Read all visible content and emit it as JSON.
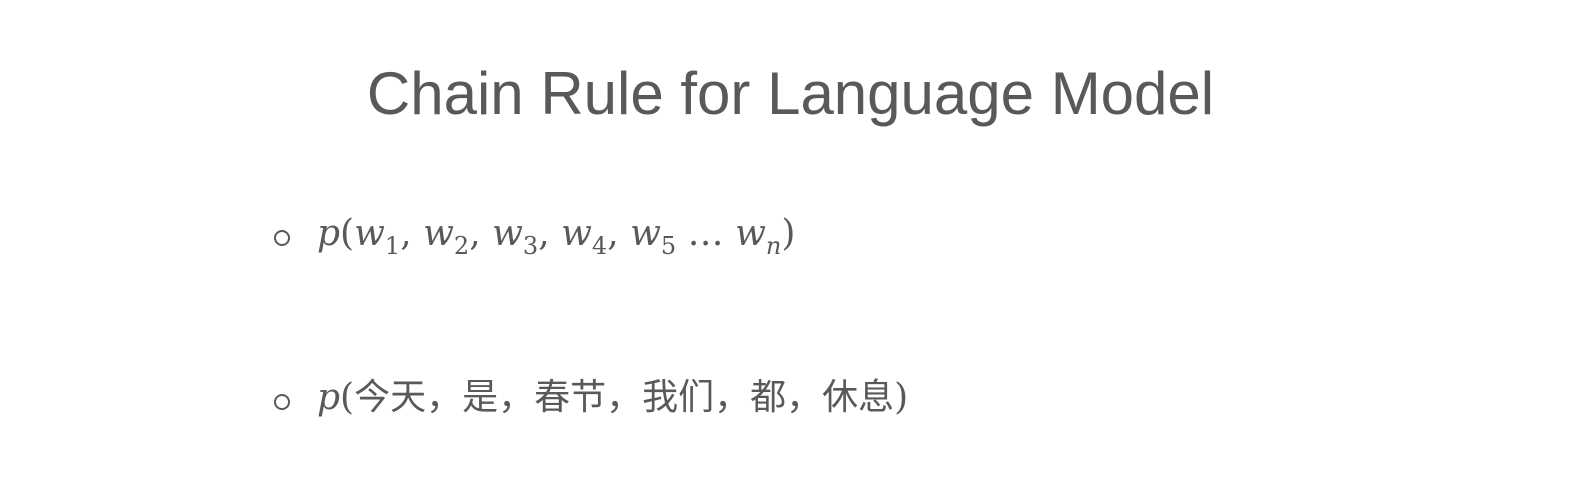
{
  "title": "Chain Rule for Language Model",
  "bullets": [
    {
      "prob_symbol": "p",
      "open_paren": "(",
      "close_paren": ")",
      "terms": [
        {
          "var": "w",
          "sub": "1",
          "sep": ", "
        },
        {
          "var": "w",
          "sub": "2",
          "sep": ", "
        },
        {
          "var": "w",
          "sub": "3",
          "sep": ", "
        },
        {
          "var": "w",
          "sub": "4",
          "sep": ", "
        },
        {
          "var": "w",
          "sub": "5",
          "sep": " … "
        },
        {
          "var": "w",
          "sub": "n",
          "sep": ""
        }
      ]
    },
    {
      "prob_symbol": "p",
      "open_paren": "(",
      "close_paren": ")",
      "content": "今天，是，春节，我们，都，休息"
    }
  ]
}
